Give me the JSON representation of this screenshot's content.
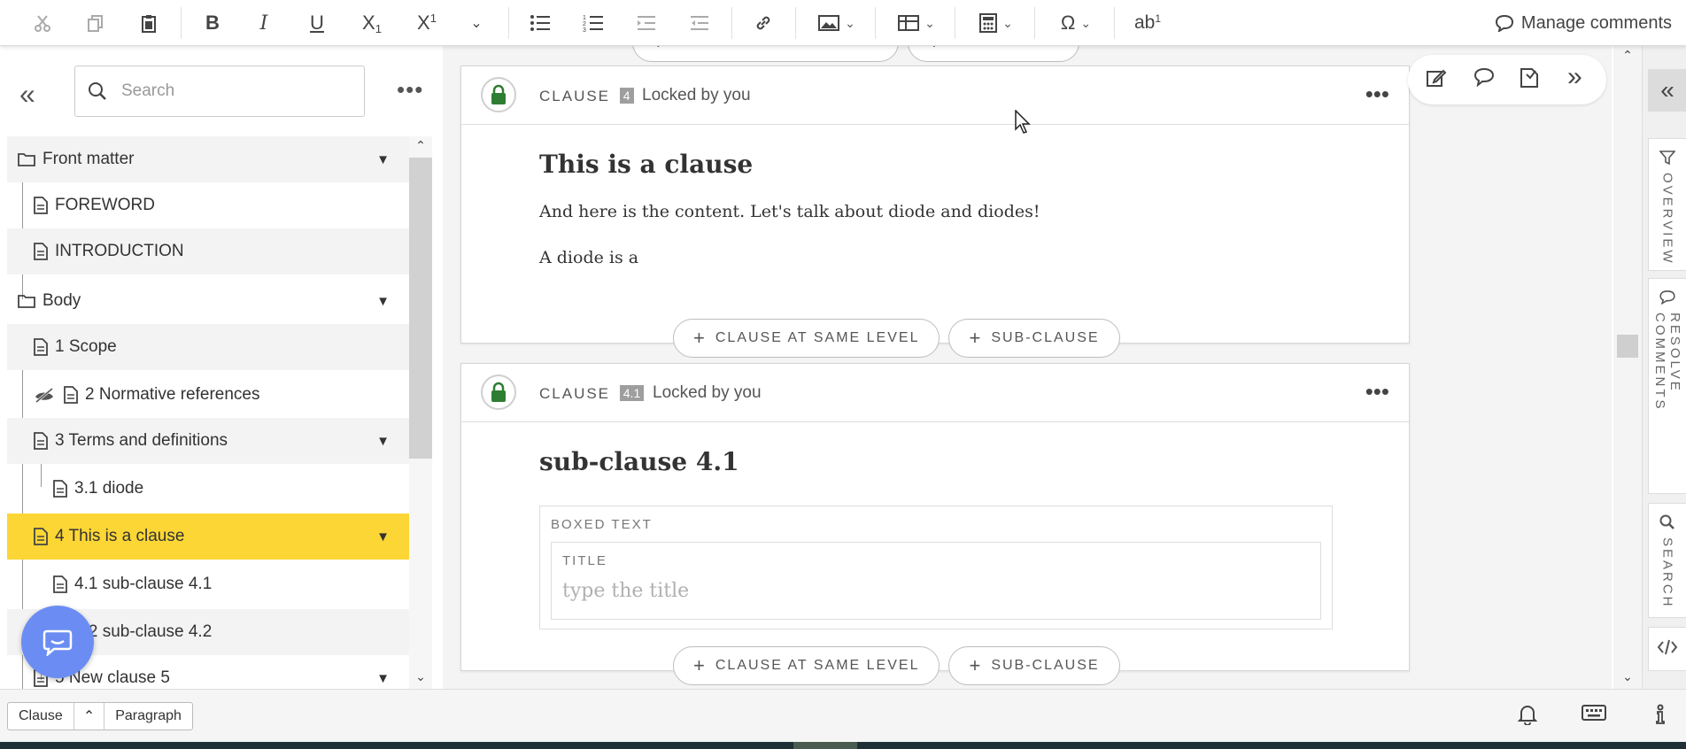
{
  "toolbar": {
    "manage_comments": "Manage comments"
  },
  "nav": {
    "search_placeholder": "Search",
    "items": [
      {
        "label": "Front matter",
        "type": "folder"
      },
      {
        "label": "FOREWORD",
        "type": "doc"
      },
      {
        "label": "INTRODUCTION",
        "type": "doc"
      },
      {
        "label": "Body",
        "type": "folder"
      },
      {
        "label": "1 Scope",
        "type": "doc"
      },
      {
        "label": "2 Normative references",
        "type": "doc"
      },
      {
        "label": "3 Terms and definitions",
        "type": "doc"
      },
      {
        "label": "3.1 diode",
        "type": "doc"
      },
      {
        "label": "4 This is a clause",
        "type": "doc",
        "selected": true
      },
      {
        "label": "4.1 sub-clause 4.1",
        "type": "doc"
      },
      {
        "label": "4.2 sub-clause 4.2",
        "type": "doc"
      },
      {
        "label": "5 New clause 5",
        "type": "doc"
      }
    ]
  },
  "clauses": [
    {
      "label": "CLAUSE",
      "number": "4",
      "locked_text": "Locked by you",
      "title": "This is a clause",
      "paragraphs": [
        "And here is the content. Let's talk about diode and diodes!",
        "A diode is a"
      ]
    },
    {
      "label": "CLAUSE",
      "number": "4.1",
      "locked_text": "Locked by you",
      "title": "sub-clause 4.1",
      "boxed_label": "BOXED TEXT",
      "title_label": "TITLE",
      "title_placeholder": "type the title"
    }
  ],
  "buttons": {
    "same_level": "CLAUSE AT SAME LEVEL",
    "sub_clause": "SUB-CLAUSE"
  },
  "rail": {
    "overview": "OVERVIEW",
    "resolve_comments": "RESOLVE COMMENTS",
    "search": "SEARCH"
  },
  "statusbar": {
    "crumb_1": "Clause",
    "crumb_2": "Paragraph"
  },
  "colors": {
    "selected": "#fcd635",
    "lock_green": "#2e7d32",
    "fab": "#6b8df3"
  }
}
